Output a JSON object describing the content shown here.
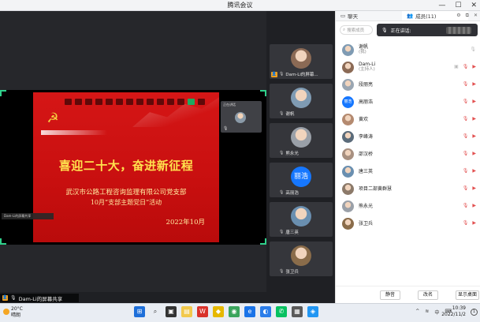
{
  "window": {
    "title": "腾讯会议",
    "minimize": "—",
    "maximize": "☐",
    "close": "✕"
  },
  "share_window": {
    "slide": {
      "headline": "喜迎二十大，奋进新征程",
      "org": "武汉市公路工程咨询监理有限公司党支部",
      "event": "10月“支部主题党日”活动",
      "date": "2022年10月"
    },
    "pip_name": "正在讲话",
    "bottom_label": "Dam-Li的屏幕共享"
  },
  "tiles": [
    {
      "name": "Dam-Li的屏幕...",
      "color": "#8b6a55",
      "host": true
    },
    {
      "name": "谢帆",
      "color": "#7f9bb3"
    },
    {
      "name": "熊永光",
      "color": "#9aa0a8"
    },
    {
      "name": "高丽浩",
      "initials": "丽浩",
      "blue": true
    },
    {
      "name": "唐三英",
      "color": "#6a8fb0"
    },
    {
      "name": "张卫兵",
      "color": "#8a6c4a"
    }
  ],
  "panel": {
    "tab_chat": "聊天",
    "tab_members": "成员(11)",
    "search_placeholder": "搜索成员",
    "speaking_label": "正在讲话:",
    "members": [
      {
        "name": "谢帆",
        "role": "(我)",
        "color": "#7f9bb3"
      },
      {
        "name": "Dam-Li",
        "role": "(主持人)",
        "color": "#8b6a55"
      },
      {
        "name": "段丽亮",
        "color": "#9aa6b2"
      },
      {
        "name": "高丽浩",
        "initials": "丽浩",
        "blue": true
      },
      {
        "name": "黄欢",
        "color": "#b48a70"
      },
      {
        "name": "李峰涛",
        "color": "#5b6b7a"
      },
      {
        "name": "邵汉桥",
        "color": "#a89080"
      },
      {
        "name": "唐三英",
        "color": "#6a8fb0"
      },
      {
        "name": "项目二部黄群慧",
        "color": "#8c7a6a"
      },
      {
        "name": "熊永光",
        "color": "#9aa0a8"
      },
      {
        "name": "张卫兵",
        "color": "#8a6c4a"
      }
    ],
    "mute_all": "静音",
    "rename": "改名",
    "show_desktop": "显示桌面"
  },
  "taskbar": {
    "temperature": "20°C",
    "weather": "晴朗",
    "ime": "中",
    "time": "10:39",
    "date": "2022/11/2"
  },
  "colors": {
    "accent": "#2fd08b",
    "slide_red": "#d51616",
    "headline_yellow": "#ffe14d",
    "avatar_blue": "#1677ff"
  }
}
